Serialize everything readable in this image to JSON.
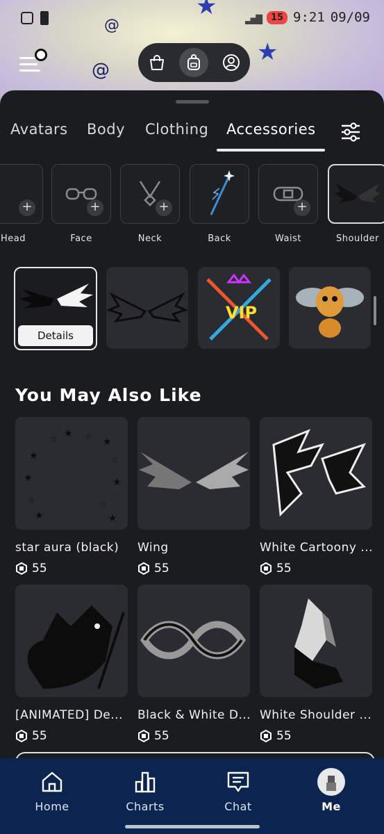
{
  "status_bar": {
    "time": "9:21",
    "date": "09/09",
    "battery_level": "15"
  },
  "top_switcher": {
    "buttons": [
      {
        "icon": "shopping-bag-icon",
        "active": false
      },
      {
        "icon": "backpack-icon",
        "active": true
      },
      {
        "icon": "avatar-profile-icon",
        "active": false
      }
    ]
  },
  "tabs": [
    "Avatars",
    "Body",
    "Clothing",
    "Accessories"
  ],
  "active_tab": "Accessories",
  "subcategories": [
    {
      "label": "Head",
      "display": "Head"
    },
    {
      "label": "Face"
    },
    {
      "label": "Neck"
    },
    {
      "label": "Back"
    },
    {
      "label": "Waist"
    },
    {
      "label": "Shoulder"
    }
  ],
  "equipped_details_label": "Details",
  "section_title": "You May Also Like",
  "items": [
    {
      "name": "star aura (black)",
      "price": "55"
    },
    {
      "name": "Wing",
      "price": "55"
    },
    {
      "name": "White Cartoony ...",
      "price": "55"
    },
    {
      "name": "[ANIMATED] De...",
      "price": "55"
    },
    {
      "name": "Black & White D...",
      "price": "55"
    },
    {
      "name": "White Shoulder ...",
      "price": "55"
    }
  ],
  "bottom_nav": [
    {
      "label": "Home",
      "icon": "home-icon"
    },
    {
      "label": "Charts",
      "icon": "charts-icon"
    },
    {
      "label": "Chat",
      "icon": "chat-icon"
    },
    {
      "label": "Me",
      "icon": "avatar-icon"
    }
  ],
  "colors": {
    "background": "#1b1c20",
    "card": "#2b2c31",
    "nav": "#0b2550"
  }
}
